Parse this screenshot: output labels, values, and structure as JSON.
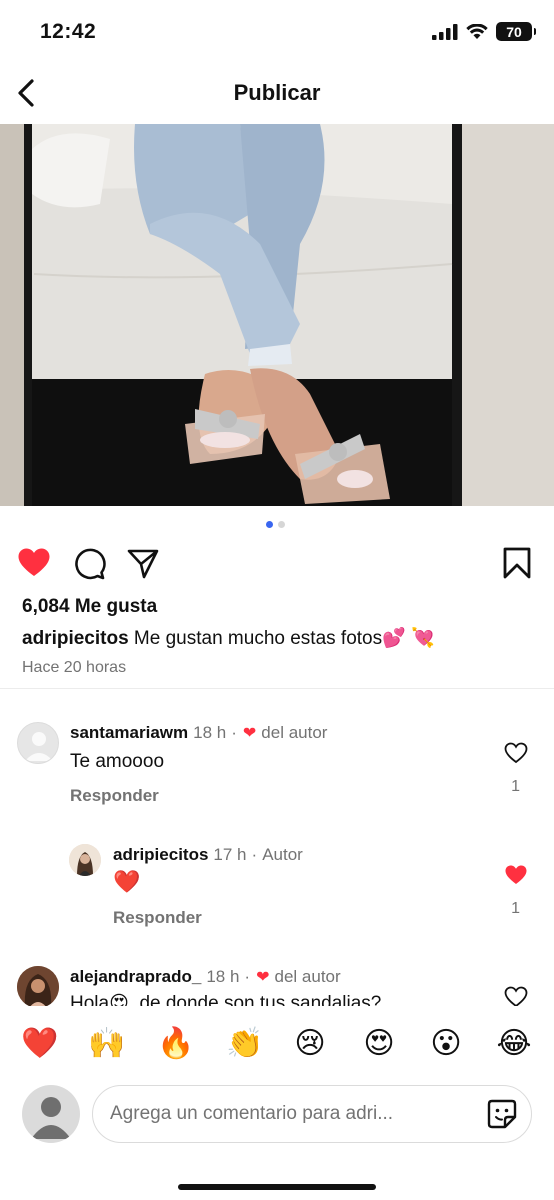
{
  "status_bar": {
    "time": "12:42",
    "battery": "70"
  },
  "header": {
    "title": "Publicar"
  },
  "post": {
    "likes_text": "6,084 Me gusta",
    "caption_user": "adripiecitos",
    "caption_text": " Me gustan mucho estas fotos💕 💘",
    "time_ago": "Hace 20 horas",
    "carousel": {
      "total": 2,
      "active": 1
    }
  },
  "comments": [
    {
      "user": "santamariawm",
      "time": "18 h",
      "separator": "·",
      "author_heart": "❤",
      "author_label": "del autor",
      "text": "Te amoooo",
      "reply_label": "Responder",
      "like_count": "1",
      "liked": false
    },
    {
      "user": "adripiecitos",
      "time": "17 h",
      "separator": "·",
      "author_label": "Autor",
      "text": "❤️",
      "reply_label": "Responder",
      "like_count": "1",
      "liked": true
    },
    {
      "user": "alejandraprado_",
      "time": "18 h",
      "separator": "·",
      "author_heart": "❤",
      "author_label": "del autor",
      "text": "Hola😍, de donde son tus sandalias?",
      "liked": false
    }
  ],
  "quick_emojis": [
    "❤️",
    "🙌",
    "🔥",
    "👏",
    "😢",
    "😍",
    "😮",
    "😂"
  ],
  "composer": {
    "placeholder": "Agrega un comentario para adri..."
  },
  "colors": {
    "like_red": "#ff3040",
    "accent_blue": "#3a66f0",
    "muted_text": "#737373"
  }
}
